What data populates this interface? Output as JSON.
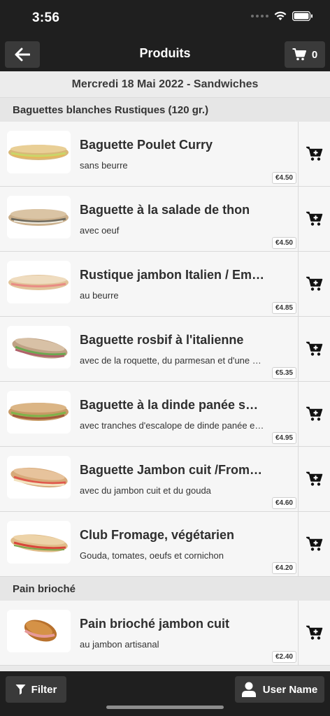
{
  "status_bar": {
    "time": "3:56"
  },
  "header": {
    "title": "Produits",
    "cart_count": "0"
  },
  "date_line": "Mercredi 18 Mai 2022 - Sandwiches",
  "sections": [
    {
      "title": "Baguettes blanches Rustiques (120 gr.)",
      "products": [
        {
          "name": "Baguette Poulet Curry",
          "desc": "sans beurre",
          "price": "€4.50"
        },
        {
          "name": "Baguette à la salade de thon",
          "desc": "avec oeuf",
          "price": "€4.50"
        },
        {
          "name": "Rustique jambon Italien / Emmental",
          "desc": "au beurre",
          "price": "€4.85"
        },
        {
          "name": "Baguette rosbif à l'italienne",
          "desc": "avec de la roquette, du parmesan et d'une sauce",
          "price": "€5.35"
        },
        {
          "name": "Baguette à la dinde panée sauce",
          "desc": "avec tranches d'escalope de dinde panée et salade",
          "price": "€4.95"
        },
        {
          "name": "Baguette Jambon cuit /Fromage",
          "desc": "avec du jambon cuit et du gouda",
          "price": "€4.60"
        },
        {
          "name": "Club Fromage, végétarien",
          "desc": "Gouda, tomates, oeufs et cornichon",
          "price": "€4.20"
        }
      ]
    },
    {
      "title": "Pain brioché",
      "products": [
        {
          "name": "Pain brioché jambon cuit",
          "desc": "au jambon artisanal",
          "price": "€2.40"
        }
      ]
    }
  ],
  "bottom_bar": {
    "filter_label": "Filter",
    "user_label": "User Name"
  },
  "icons": {
    "back": "arrow-left-icon",
    "cart": "shopping-cart-icon",
    "add_to_cart": "cart-plus-icon",
    "filter": "filter-icon",
    "user": "user-icon"
  },
  "colors": {
    "bar_background": "#1f1f1f",
    "button_background": "#3a3a3a",
    "list_background": "#f6f6f6"
  }
}
